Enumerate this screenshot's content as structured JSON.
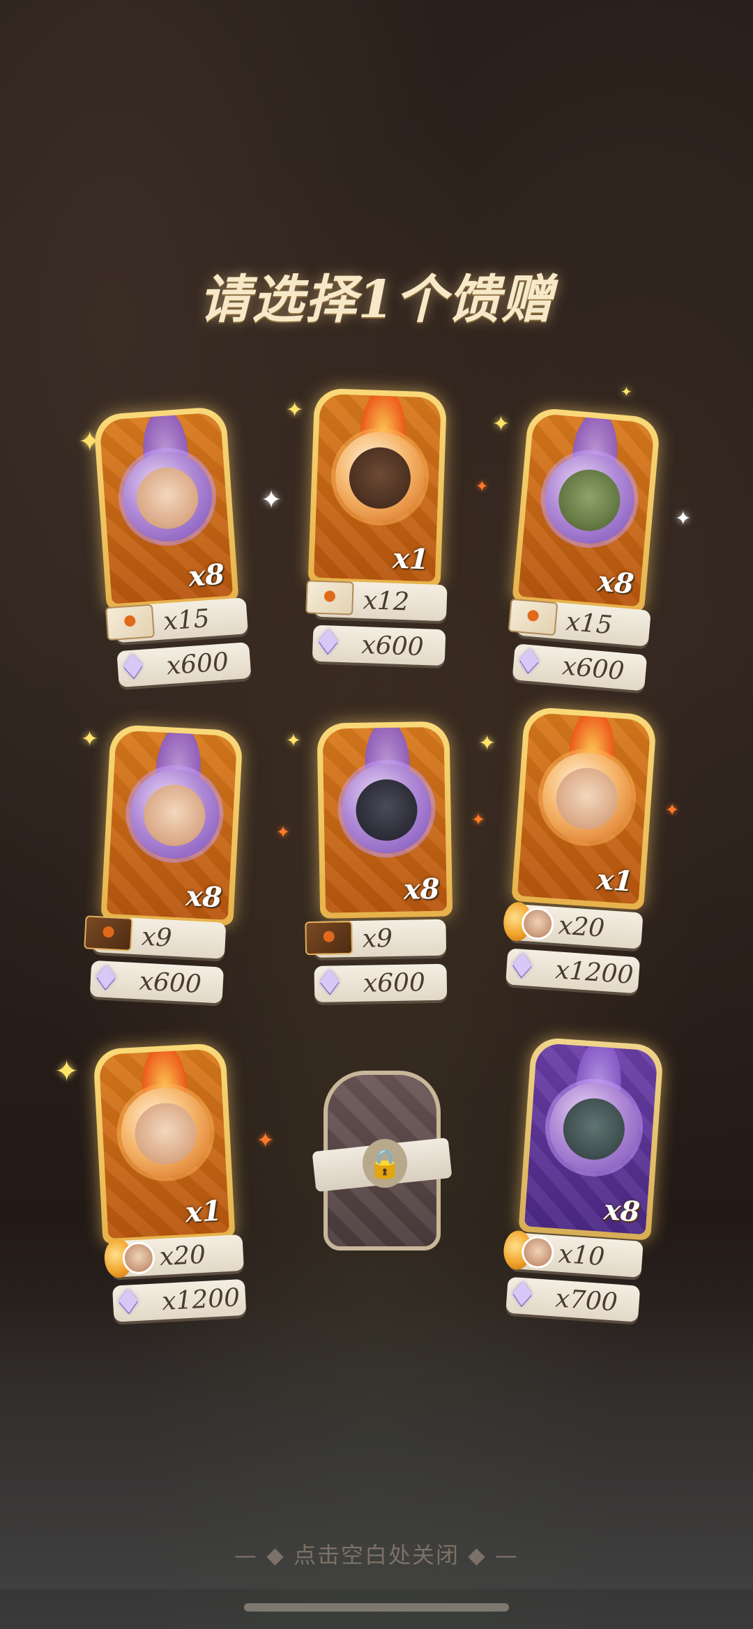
{
  "title": "请选择1个馈赠",
  "close_hint": "— ◆ 点击空白处关闭 ◆ —",
  "cards": [
    {
      "qty": "x8",
      "style": "purple-orb",
      "rewards": [
        {
          "icon": "letter-icon",
          "text": "x15"
        },
        {
          "icon": "diamond-icon",
          "text": "x600"
        }
      ]
    },
    {
      "qty": "x1",
      "style": "fire-orb",
      "rewards": [
        {
          "icon": "letter-icon",
          "text": "x12"
        },
        {
          "icon": "diamond-icon",
          "text": "x600"
        }
      ]
    },
    {
      "qty": "x8",
      "style": "purple-orb",
      "rewards": [
        {
          "icon": "letter-icon",
          "text": "x15"
        },
        {
          "icon": "diamond-icon",
          "text": "x600"
        }
      ]
    },
    {
      "qty": "x8",
      "style": "purple-orb",
      "rewards": [
        {
          "icon": "letter-icon",
          "text": "x9"
        },
        {
          "icon": "diamond-icon",
          "text": "x600"
        }
      ]
    },
    {
      "qty": "x8",
      "style": "purple-orb",
      "rewards": [
        {
          "icon": "letter-icon",
          "text": "x9"
        },
        {
          "icon": "diamond-icon",
          "text": "x600"
        }
      ]
    },
    {
      "qty": "x1",
      "style": "fire-orb",
      "rewards": [
        {
          "icon": "token-icon",
          "text": "x20"
        },
        {
          "icon": "diamond-icon",
          "text": "x1200"
        }
      ]
    },
    {
      "qty": "x1",
      "style": "fire-orb",
      "rewards": [
        {
          "icon": "token-icon",
          "text": "x20"
        },
        {
          "icon": "diamond-icon",
          "text": "x1200"
        }
      ]
    },
    {
      "qty": "x8",
      "style": "purple-card",
      "rewards": [
        {
          "icon": "token-icon",
          "text": "x10"
        },
        {
          "icon": "diamond-icon",
          "text": "x700"
        }
      ]
    }
  ],
  "locked_slot": {
    "icon": "lock-icon"
  },
  "colors": {
    "gold": "#f9d97a",
    "orange": "#d97a1c",
    "purple": "#6b3fa8",
    "reward_bg": "#f4eee2"
  }
}
